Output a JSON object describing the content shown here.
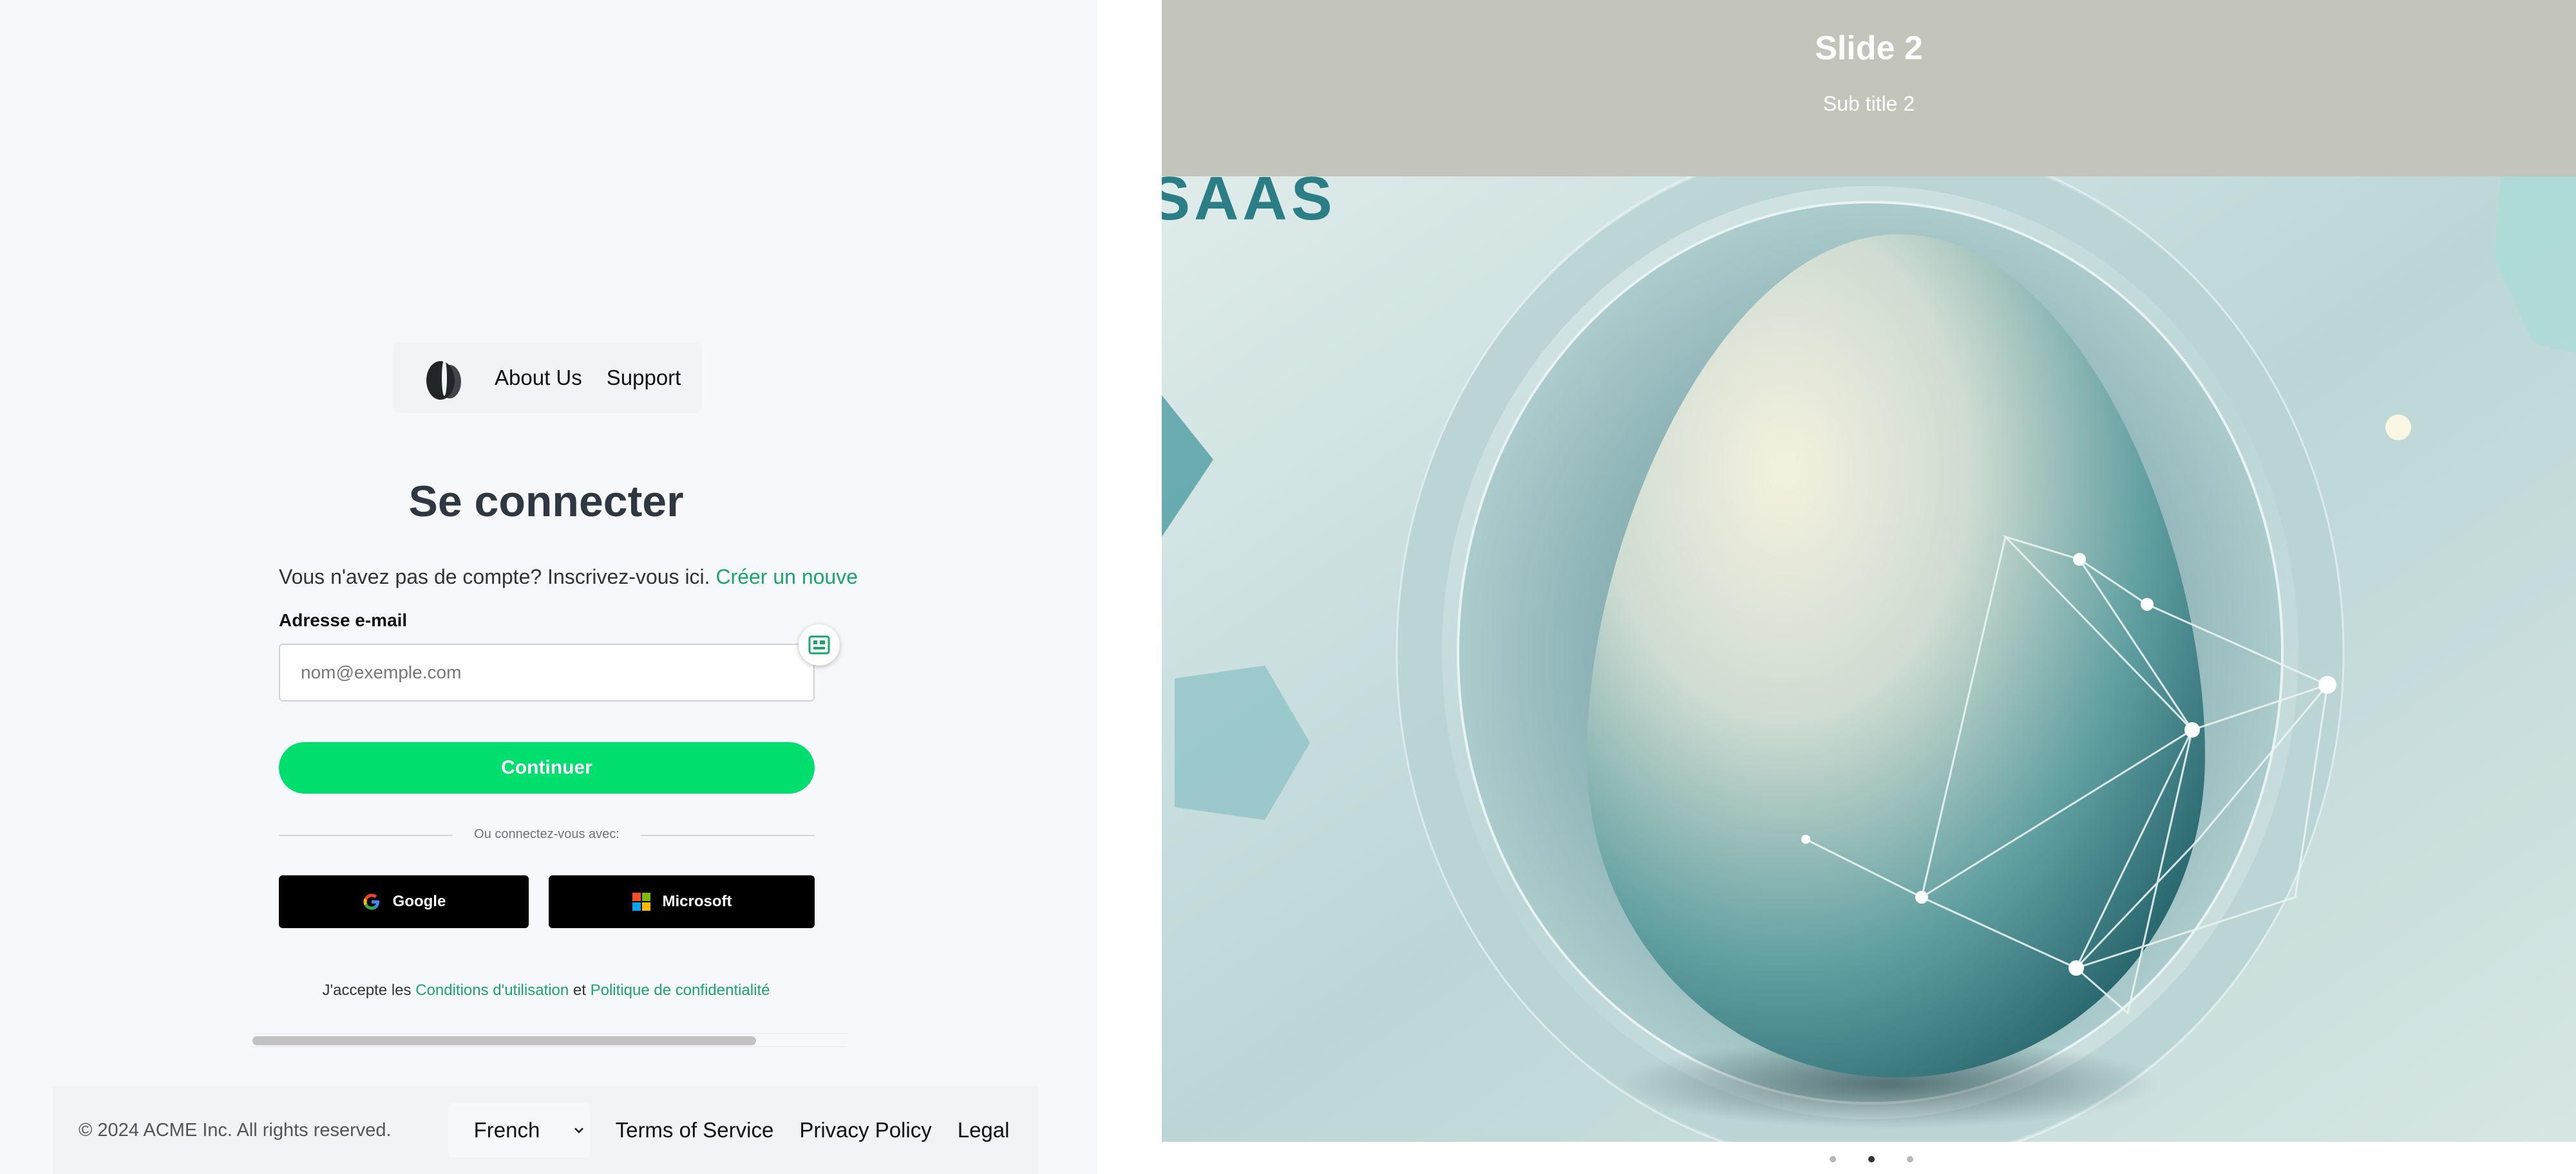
{
  "nav": {
    "about": "About Us",
    "support": "Support"
  },
  "login": {
    "title": "Se connecter",
    "signup_prompt": "Vous n'avez pas de compte? Inscrivez-vous ici.",
    "signup_link": "Créer un nouve",
    "email_label": "Adresse e-mail",
    "email_placeholder": "nom@exemple.com",
    "email_value": "",
    "continue": "Continuer",
    "divider": "Ou connectez-vous avec:",
    "google": "Google",
    "microsoft": "Microsoft",
    "terms_prefix": "J'accepte les",
    "terms_link": "Conditions d'utilisation",
    "terms_and": "et",
    "privacy_link": "Politique de confidentialité"
  },
  "footer": {
    "copyright": "© 2024 ACME Inc. All rights reserved.",
    "language": "French",
    "terms": "Terms of Service",
    "privacy": "Privacy Policy",
    "legal": "Legal"
  },
  "carousel": {
    "title": "Slide 2",
    "subtitle": "Sub title 2",
    "image_text": "SAAS",
    "slide_count": 3,
    "active_index": 1
  },
  "colors": {
    "accent": "#00de6e",
    "link": "#1aa56a",
    "slide_header": "#c3c5bb"
  }
}
